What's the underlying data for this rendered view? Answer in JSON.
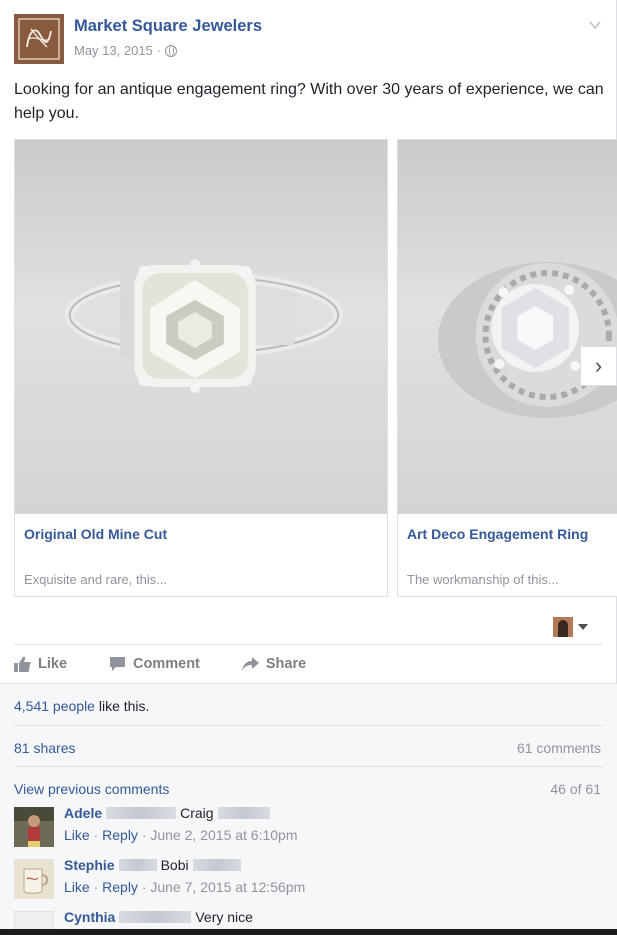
{
  "post": {
    "page_name": "Market Square Jewelers",
    "date": "May 13, 2015",
    "separator": "·",
    "privacy_icon": "globe-icon",
    "menu_icon": "chevron-down-icon",
    "text": "Looking for an antique engagement ring? With over 30 years of experience, we can help you."
  },
  "carousel": {
    "cards": [
      {
        "title": "Original Old Mine Cut",
        "description": "Exquisite and rare, this..."
      },
      {
        "title": "Art Deco Engagement Ring",
        "description": "The workmanship of this..."
      }
    ],
    "next_label": "›"
  },
  "actions": {
    "like": "Like",
    "comment": "Comment",
    "share": "Share"
  },
  "feedback": {
    "likes_count": "4,541 people",
    "likes_suffix": " like this.",
    "shares": "81 shares",
    "comments": "61 comments",
    "view_previous": "View previous comments",
    "pager": "46 of 61"
  },
  "comments": [
    {
      "name": "Adele",
      "text": "Craig",
      "like": "Like",
      "reply": "Reply",
      "time": "June 2, 2015 at 6:10pm"
    },
    {
      "name": "Stephie",
      "text": "Bobi",
      "like": "Like",
      "reply": "Reply",
      "time": "June 7, 2015 at 12:56pm"
    },
    {
      "name": "Cynthia",
      "text": "Very nice"
    }
  ],
  "colors": {
    "link": "#365899",
    "muted": "#90949c",
    "text": "#1d2129",
    "feedback_bg": "#f6f7f9"
  }
}
